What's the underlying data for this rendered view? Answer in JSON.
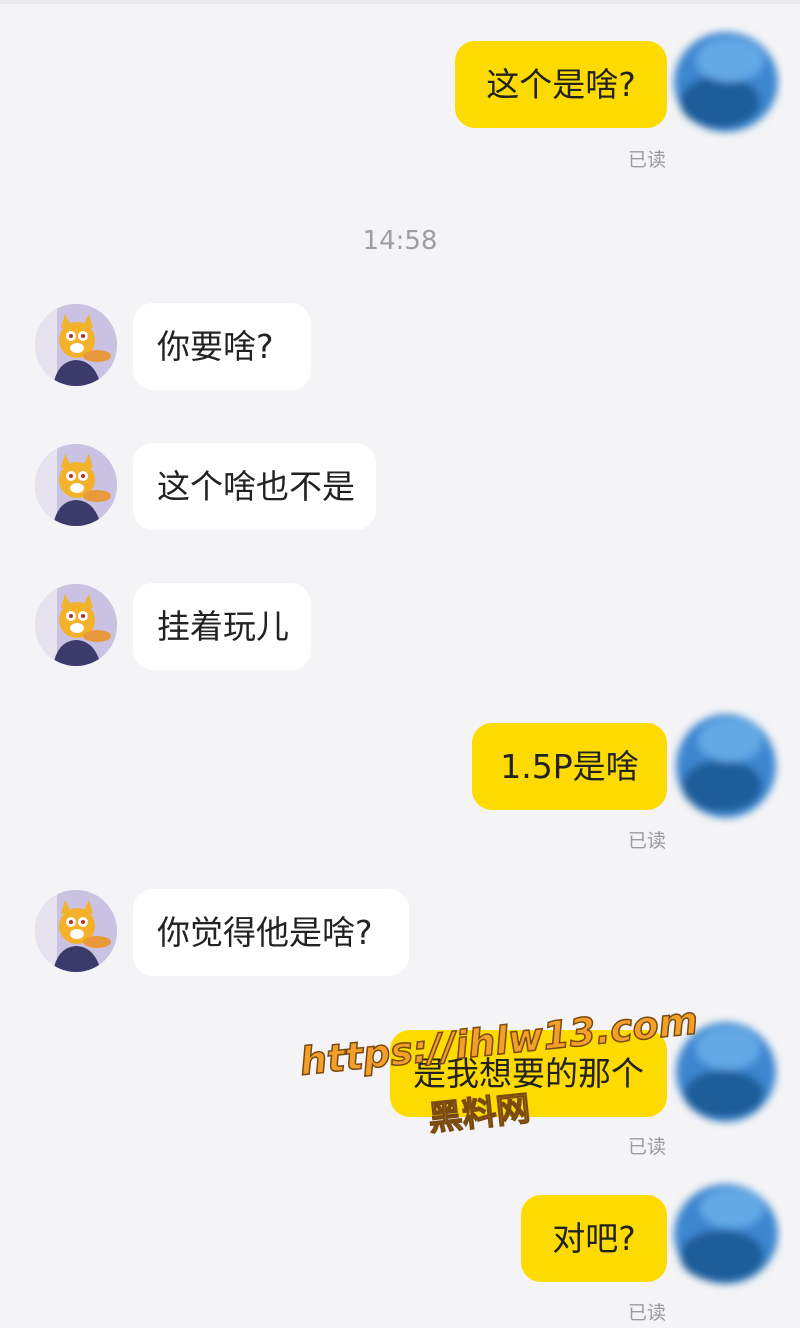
{
  "timestamp": "14:58",
  "read_label": "已读",
  "messages": [
    {
      "side": "out",
      "text": "这个是啥?"
    },
    {
      "side": "in",
      "text": "你要啥?"
    },
    {
      "side": "in",
      "text": "这个啥也不是"
    },
    {
      "side": "in",
      "text": "挂着玩儿"
    },
    {
      "side": "out",
      "text": "1.5P是啥"
    },
    {
      "side": "in",
      "text": "你觉得他是啥?"
    },
    {
      "side": "out",
      "text": "是我想要的那个"
    },
    {
      "side": "out",
      "text": "对吧?"
    }
  ],
  "watermark": {
    "url": "https://ihlw13.com",
    "name": "黑料网"
  },
  "colors": {
    "outgoing_bubble": "#fddb00",
    "incoming_bubble": "#ffffff",
    "background": "#f4f4f6",
    "watermark": "#f2a02a"
  },
  "icons": {
    "incoming_avatar": "cartoon-cat-avatar",
    "outgoing_avatar": "blurred-blue-avatar"
  }
}
